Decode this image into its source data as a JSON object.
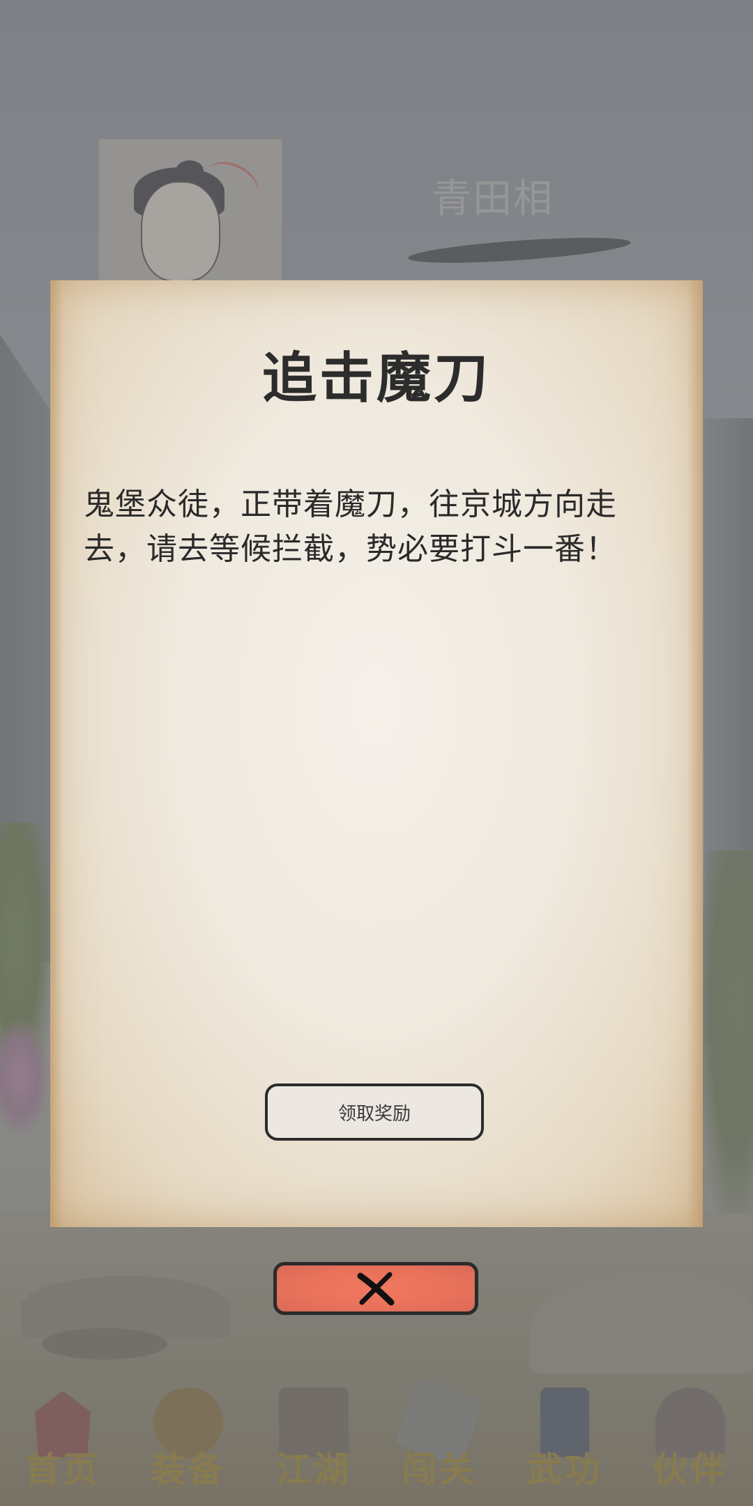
{
  "hero": {
    "name": "青田相"
  },
  "dialog": {
    "title": "追击魔刀",
    "body": "鬼堡众徒，正带着魔刀，往京城方向走去，请去等候拦截，势必要打斗一番！",
    "claim_button_label": "领取奖励",
    "close_icon": "close-x-icon"
  },
  "bottom_nav": {
    "items": [
      {
        "label": "首页",
        "icon": "home-pavilion-icon"
      },
      {
        "label": "装备",
        "icon": "equipment-jar-icon"
      },
      {
        "label": "江湖",
        "icon": "world-scroll-icon"
      },
      {
        "label": "闯关",
        "icon": "crossed-swords-icon"
      },
      {
        "label": "武功",
        "icon": "kungfu-book-icon"
      },
      {
        "label": "伙伴",
        "icon": "partner-people-icon"
      }
    ]
  },
  "colors": {
    "parchment": "#efe9de",
    "close_button": "#e8715b",
    "title_text": "#2c2c2c",
    "nav_label": "#8a7b45"
  }
}
